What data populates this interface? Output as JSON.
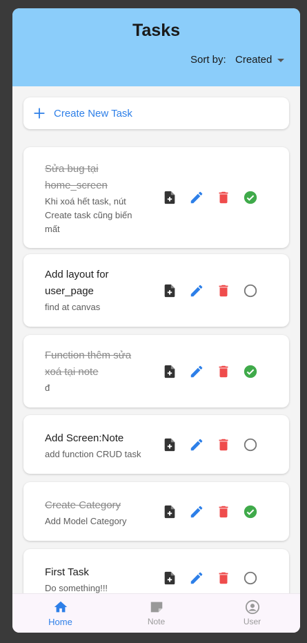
{
  "header": {
    "title": "Tasks",
    "sort_label": "Sort by:",
    "sort_value": "Created"
  },
  "create_button": {
    "label": "Create New Task"
  },
  "tasks": [
    {
      "title": "Sửa bug tại home_screen",
      "description": "Khi xoá hết task, nút Create task cũng biến mất",
      "completed": true
    },
    {
      "title": "Add layout for user_page",
      "description": "find at canvas",
      "completed": false
    },
    {
      "title": "Function thêm sửa xoá tại note",
      "description": "đ",
      "completed": true
    },
    {
      "title": "Add Screen:Note",
      "description": "add function CRUD task",
      "completed": false
    },
    {
      "title": "Create Category",
      "description": "Add Model Category",
      "completed": true
    },
    {
      "title": "First Task",
      "description": "Do something!!!",
      "completed": false
    }
  ],
  "nav": {
    "items": [
      {
        "label": "Home",
        "icon": "home-icon",
        "active": true
      },
      {
        "label": "Note",
        "icon": "note-icon",
        "active": false
      },
      {
        "label": "User",
        "icon": "user-icon",
        "active": false
      }
    ]
  },
  "colors": {
    "header_bg": "#8bcdfa",
    "accent": "#2d7fe8",
    "delete": "#ef4c4c",
    "done": "#3faa4a",
    "note_icon": "#333333"
  }
}
